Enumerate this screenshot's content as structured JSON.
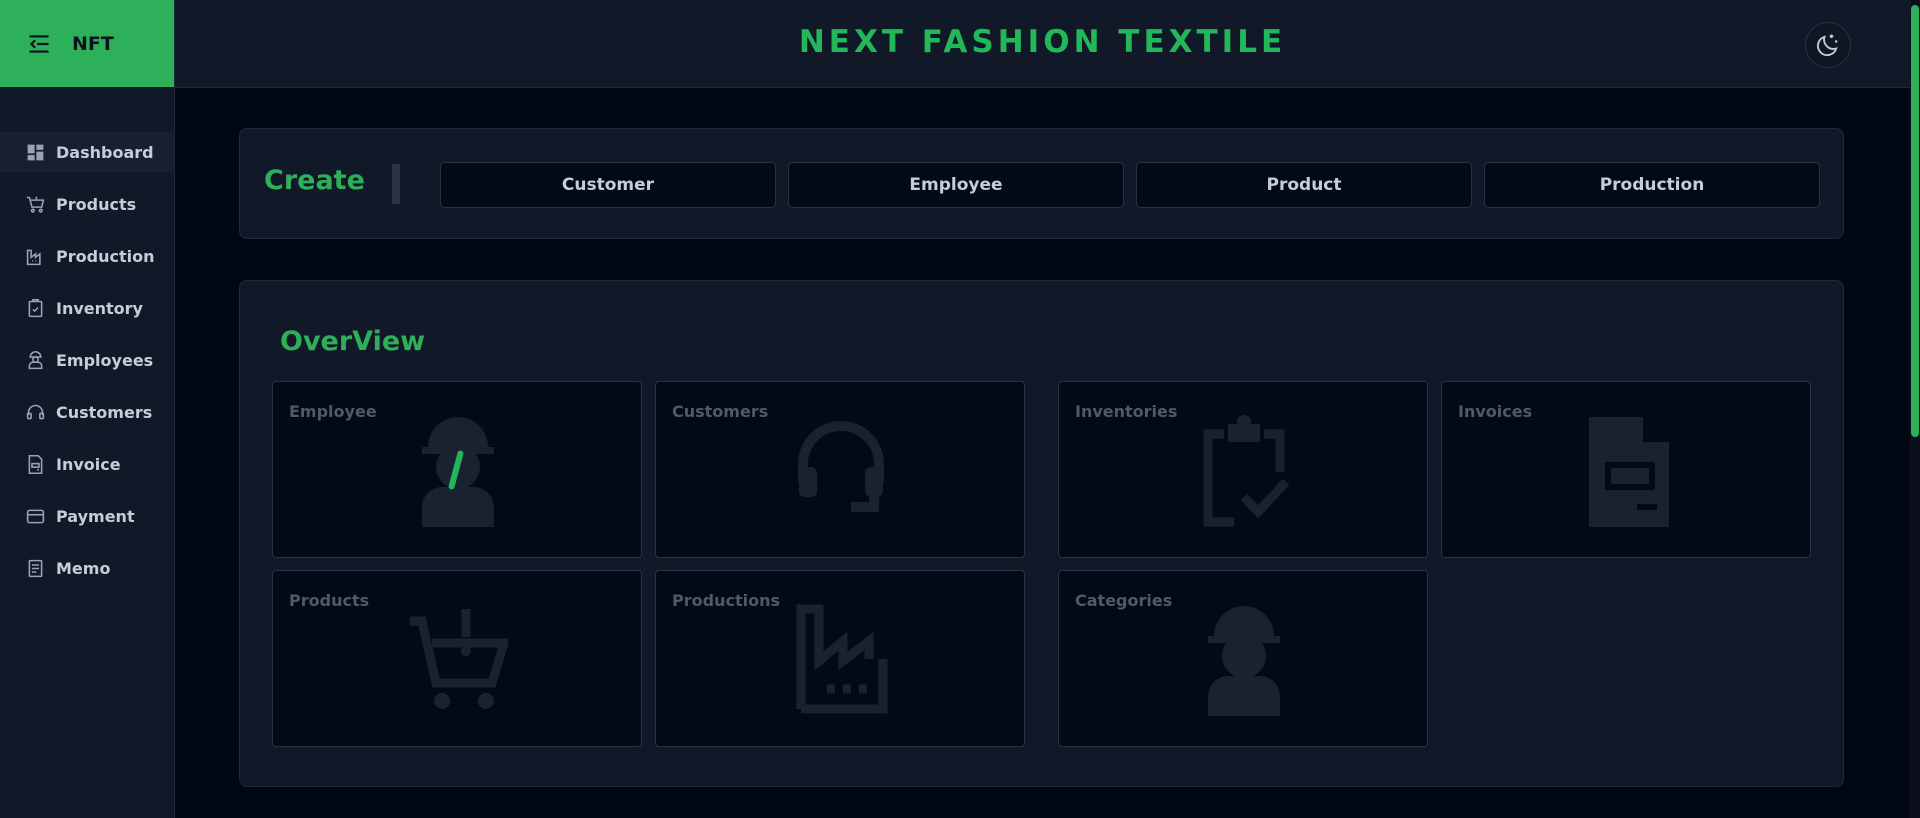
{
  "brand": {
    "label": "NFT"
  },
  "site": {
    "title": "NEXT FASHION TEXTILE"
  },
  "sidebar": {
    "items": [
      {
        "label": "Dashboard",
        "icon": "dashboard-icon"
      },
      {
        "label": "Products",
        "icon": "cart-icon"
      },
      {
        "label": "Production",
        "icon": "factory-icon"
      },
      {
        "label": "Inventory",
        "icon": "clipboard-check-icon"
      },
      {
        "label": "Employees",
        "icon": "worker-icon"
      },
      {
        "label": "Customers",
        "icon": "headset-icon"
      },
      {
        "label": "Invoice",
        "icon": "document-icon"
      },
      {
        "label": "Payment",
        "icon": "card-icon"
      },
      {
        "label": "Memo",
        "icon": "memo-icon"
      }
    ]
  },
  "create": {
    "title": "Create",
    "buttons": [
      "Customer",
      "Employee",
      "Product",
      "Production"
    ]
  },
  "overview": {
    "title": "OverView",
    "cards": [
      {
        "label": "Employee",
        "icon": "worker-icon"
      },
      {
        "label": "Customers",
        "icon": "headset-icon"
      },
      {
        "label": "Inventories",
        "icon": "clipboard-check-icon"
      },
      {
        "label": "Invoices",
        "icon": "document-icon"
      },
      {
        "label": "Products",
        "icon": "cart-icon"
      },
      {
        "label": "Productions",
        "icon": "factory-icon"
      },
      {
        "label": "Categories",
        "icon": "worker-icon"
      }
    ]
  },
  "colors": {
    "accent": "#2eb05a",
    "background": "#010814",
    "panel": "#111827"
  }
}
